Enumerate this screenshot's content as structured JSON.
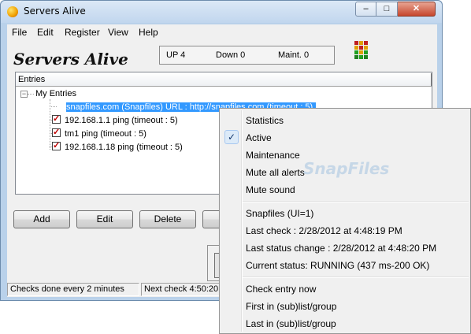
{
  "window": {
    "title": "Servers Alive",
    "min": "–",
    "max": "□",
    "close": "✕"
  },
  "menu": [
    "File",
    "Edit",
    "Register",
    "View",
    "Help"
  ],
  "logo": "Servers Alive",
  "summary": {
    "up": "UP  4",
    "down": "Down 0",
    "maint": "Maint. 0"
  },
  "tree": {
    "header": "Entries",
    "root": "My Entries",
    "toggle": "−",
    "entries": [
      "snapfiles.com (Snapfiles) URL : http://snapfiles.com  (timeout :  5)",
      "192.168.1.1  ping   (timeout :  5)",
      "tm1  ping   (timeout :  5)",
      "192.168.1.18  ping   (timeout :  5)"
    ]
  },
  "buttons": [
    "Add",
    "Edit",
    "Delete"
  ],
  "statusbar": {
    "checks": "Checks done every  2 minutes",
    "next": "Next check 4:50:20"
  },
  "context_menu": {
    "group1": [
      "Statistics",
      "Active",
      "Maintenance",
      "Mute all alerts",
      "Mute sound"
    ],
    "active_check": "✓",
    "group2": [
      "Snapfiles (UI=1)",
      "Last check : 2/28/2012 at 4:48:19 PM",
      "Last status change : 2/28/2012 at 4:48:20 PM",
      "Current status: RUNNING (437 ms-200 OK)"
    ],
    "group3": [
      "Check entry now",
      "First in (sub)list/group",
      "Last in (sub)list/group"
    ]
  },
  "watermark": "SnapFiles",
  "colors": {
    "selection": "#3399ff",
    "check_red": "#c00000",
    "window_frame": "#b9d1ea"
  }
}
